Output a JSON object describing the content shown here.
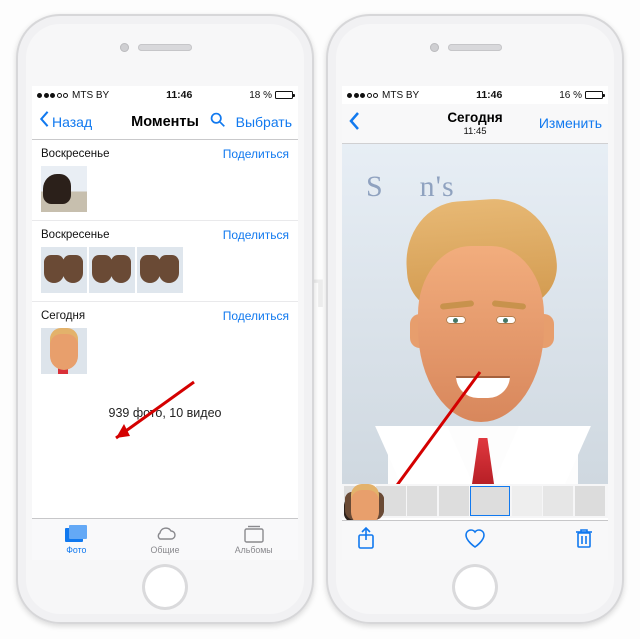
{
  "left": {
    "status": {
      "carrier": "MTS BY",
      "time": "11:46",
      "battery_pct_text": "18 %",
      "battery_level_pct": 18,
      "signal_bars": 3
    },
    "nav": {
      "back": "Назад",
      "title": "Моменты",
      "select": "Выбрать"
    },
    "sections": [
      {
        "label": "Воскресенье",
        "share": "Поделиться",
        "thumbs": 1
      },
      {
        "label": "Воскресенье",
        "share": "Поделиться",
        "thumbs": 3
      },
      {
        "label": "Сегодня",
        "share": "Поделиться",
        "thumbs": 1
      }
    ],
    "summary": "939 фото, 10 видео",
    "tabs": {
      "photos": "Фото",
      "shared": "Общие",
      "albums": "Альбомы"
    }
  },
  "right": {
    "status": {
      "carrier": "MTS BY",
      "time": "11:46",
      "battery_pct_text": "16 %",
      "battery_level_pct": 16,
      "signal_bars": 3
    },
    "nav": {
      "title": "Сегодня",
      "subtitle": "11:45",
      "edit": "Изменить"
    }
  },
  "watermark": "Яблык"
}
